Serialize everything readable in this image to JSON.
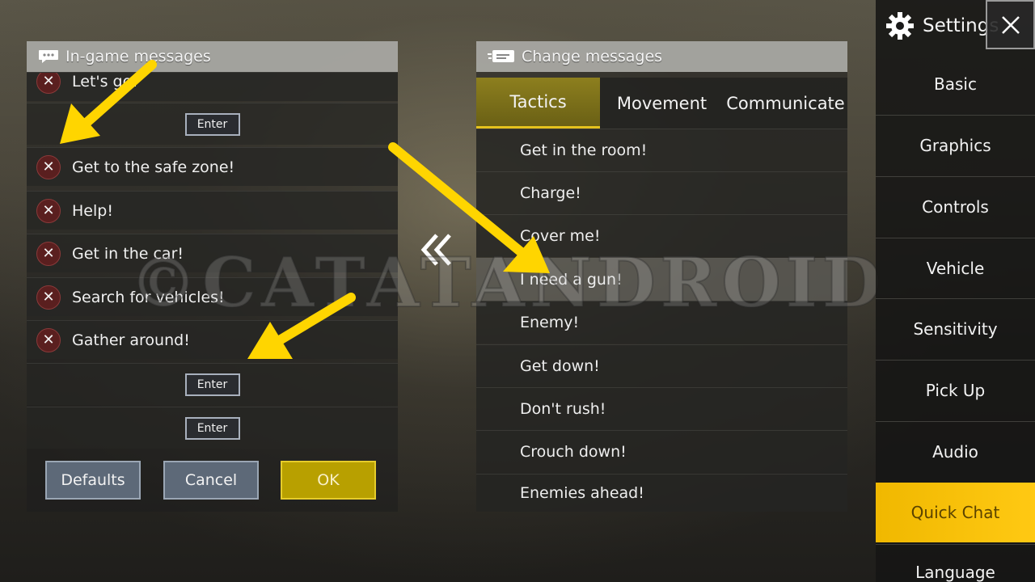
{
  "left_panel": {
    "title": "In-game messages",
    "rows": [
      {
        "type": "message",
        "text": "Let's go!"
      },
      {
        "type": "enter",
        "label": "Enter"
      },
      {
        "type": "message",
        "text": "Get to the safe zone!"
      },
      {
        "type": "message",
        "text": "Help!"
      },
      {
        "type": "message",
        "text": "Get in the car!"
      },
      {
        "type": "message",
        "text": "Search for vehicles!"
      },
      {
        "type": "message",
        "text": "Gather around!"
      },
      {
        "type": "enter",
        "label": "Enter"
      },
      {
        "type": "enter",
        "label": "Enter"
      }
    ],
    "buttons": {
      "defaults": "Defaults",
      "cancel": "Cancel",
      "ok": "OK"
    }
  },
  "right_panel": {
    "title": "Change messages",
    "tabs": [
      "Tactics",
      "Movement",
      "Communicate"
    ],
    "active_tab": "Tactics",
    "messages": [
      "Get in the room!",
      "Charge!",
      "Cover me!",
      "I need a gun!",
      "Enemy!",
      "Get down!",
      "Don't rush!",
      "Crouch down!",
      "Enemies ahead!"
    ]
  },
  "sidebar": {
    "title": "Settings",
    "items": [
      "Basic",
      "Graphics",
      "Controls",
      "Vehicle",
      "Sensitivity",
      "Pick Up",
      "Audio",
      "Quick Chat",
      "Language"
    ],
    "active_item": "Quick Chat"
  },
  "watermark": "©CATATANDROID",
  "colors": {
    "accent": "#ffc913",
    "remove": "#5a1f1f",
    "annotation_arrow": "#ffd500",
    "ok_button": "#b8a000"
  }
}
